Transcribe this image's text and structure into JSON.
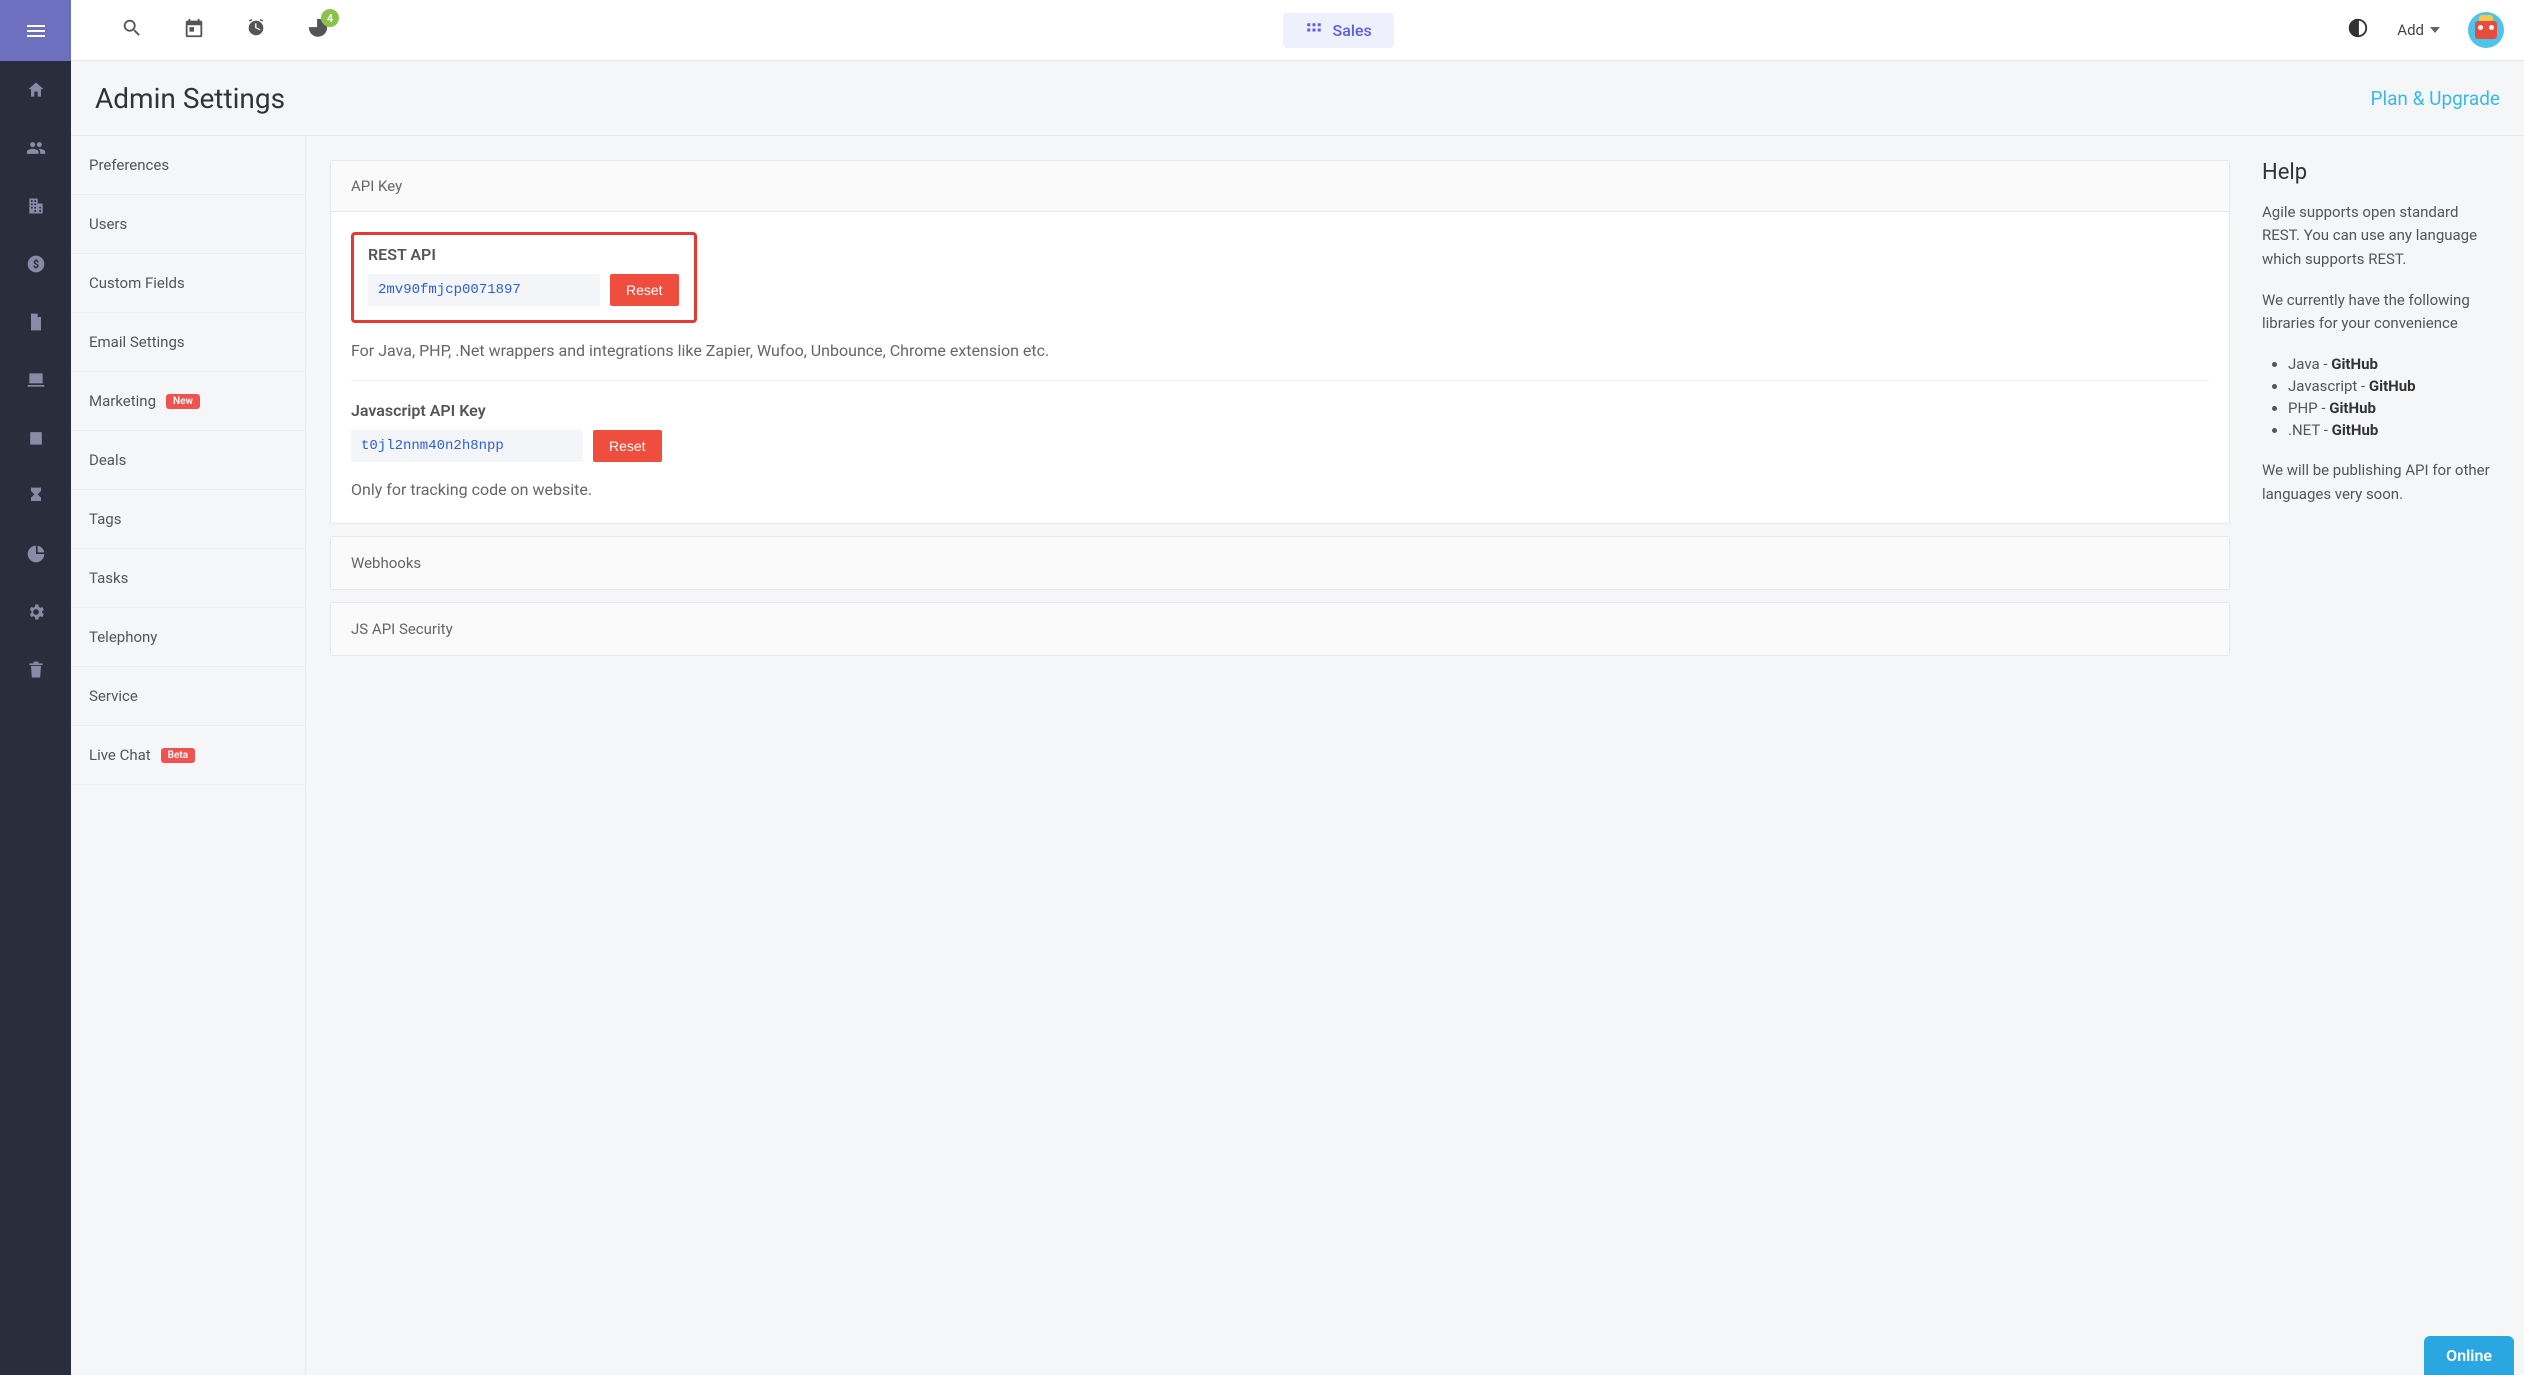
{
  "topbar": {
    "badge_count": "4",
    "sales_label": "Sales",
    "add_label": "Add"
  },
  "page": {
    "title": "Admin Settings",
    "plan_link": "Plan & Upgrade"
  },
  "settings_nav": {
    "items": [
      {
        "label": "Preferences"
      },
      {
        "label": "Users"
      },
      {
        "label": "Custom Fields"
      },
      {
        "label": "Email Settings"
      },
      {
        "label": "Marketing",
        "pill": "New"
      },
      {
        "label": "Deals"
      },
      {
        "label": "Tags"
      },
      {
        "label": "Tasks"
      },
      {
        "label": "Telephony"
      },
      {
        "label": "Service"
      },
      {
        "label": "Live Chat",
        "pill": "Beta"
      }
    ]
  },
  "api": {
    "panel_title": "API Key",
    "rest_label": "REST API",
    "rest_key": "2mv90fmjcp0071897",
    "rest_reset": "Reset",
    "rest_note": "For Java, PHP, .Net wrappers and integrations like Zapier, Wufoo, Unbounce, Chrome extension etc.",
    "js_label": "Javascript API Key",
    "js_key": "t0jl2nnm40n2h8npp",
    "js_reset": "Reset",
    "js_note": "Only for tracking code on website."
  },
  "collapsed_panels": {
    "webhooks": "Webhooks",
    "js_security": "JS API Security"
  },
  "help": {
    "title": "Help",
    "p1": "Agile supports open standard REST. You can use any language which supports REST.",
    "p2": "We currently have the following libraries for your convenience",
    "libs": [
      {
        "lang": "Java",
        "link": "GitHub"
      },
      {
        "lang": "Javascript",
        "link": "GitHub"
      },
      {
        "lang": "PHP",
        "link": "GitHub"
      },
      {
        "lang": ".NET",
        "link": "GitHub"
      }
    ],
    "p3": "We will be publishing API for other languages very soon."
  },
  "online": "Online"
}
